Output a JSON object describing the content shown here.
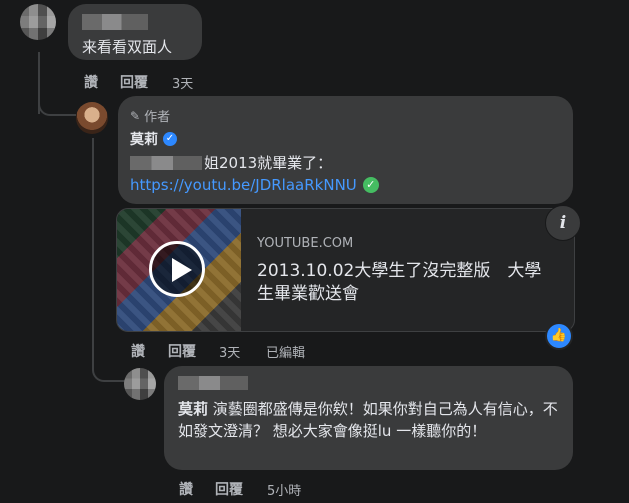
{
  "comment1": {
    "text": "来看看双面人",
    "actions": {
      "like": "讚",
      "reply": "回覆",
      "time": "3天"
    }
  },
  "reply1": {
    "author_badge": "作者",
    "author_name": "莫莉",
    "text_suffix": "姐2013就畢業了：",
    "link": "https://youtu.be/JDRlaaRkNNU",
    "preview": {
      "source": "YOUTUBE.COM",
      "title": "2013.10.02大學生了沒完整版　大學生畢業歡送會"
    },
    "info_icon": "i",
    "actions": {
      "like": "讚",
      "reply": "回覆",
      "time": "3天",
      "edited": "已編輯"
    }
  },
  "reply2": {
    "mention": "莫莉",
    "text": " 演藝圈都盛傳是你欸！如果你對自己為人有信心，不如發文澄清？ 想必大家會像挺lu 一樣聽你的！",
    "actions": {
      "like": "讚",
      "reply": "回覆",
      "time": "5小時"
    }
  },
  "colors": {
    "link": "#4599ff",
    "verified": "#2d88ff",
    "verified_check": "#45bd62",
    "like_badge": "#2d88ff"
  }
}
